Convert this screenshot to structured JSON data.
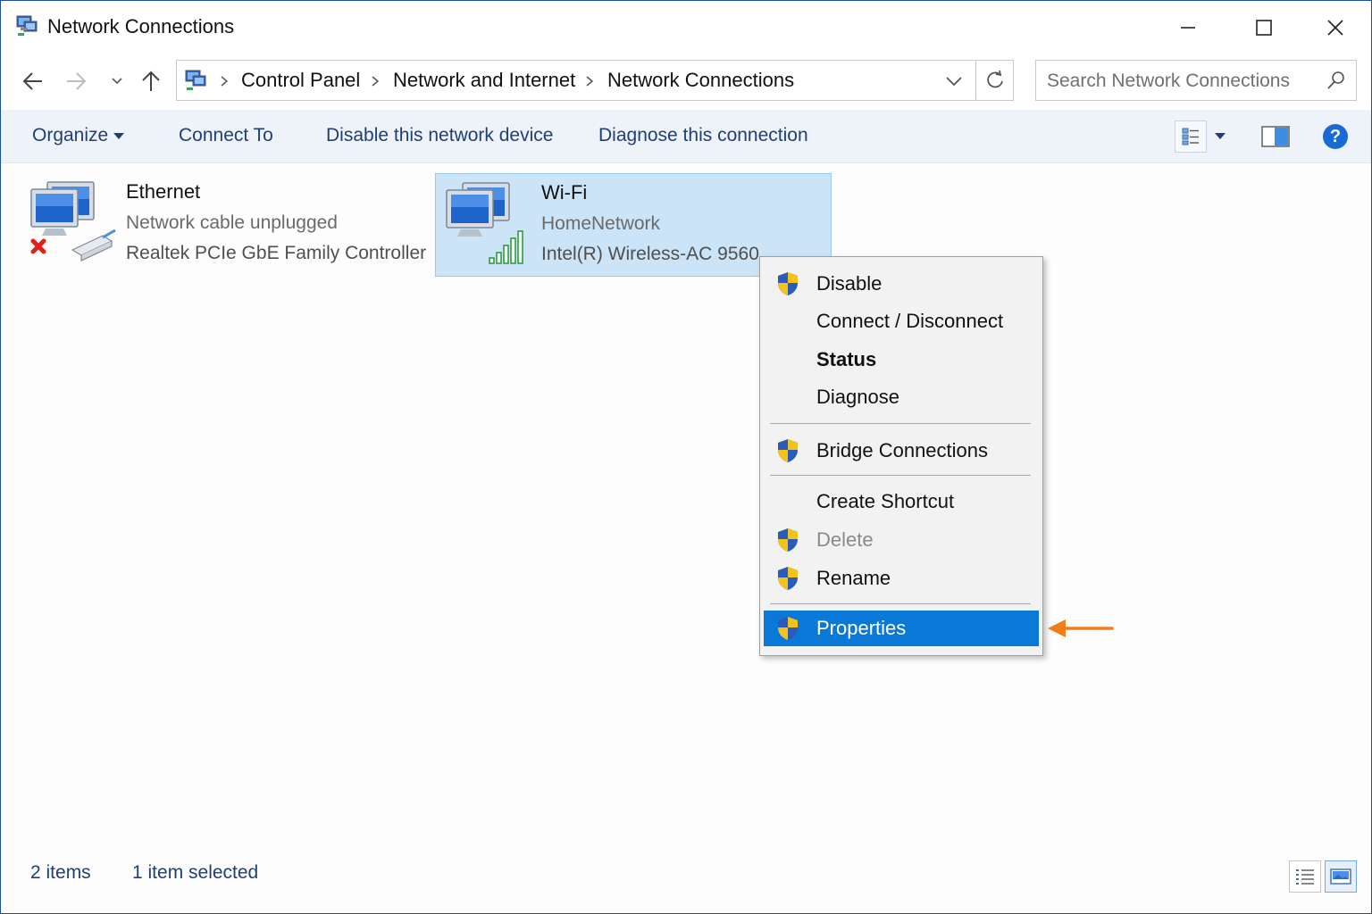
{
  "window": {
    "title": "Network Connections",
    "controls": {
      "minimize": "minimize",
      "maximize": "maximize",
      "close": "close"
    }
  },
  "address": {
    "breadcrumbs": [
      "Control Panel",
      "Network and Internet",
      "Network Connections"
    ],
    "search_placeholder": "Search Network Connections"
  },
  "commands": {
    "organize": "Organize",
    "connect_to": "Connect To",
    "disable_device": "Disable this network device",
    "diagnose_connection": "Diagnose this connection",
    "help": "?"
  },
  "connections": [
    {
      "name": "Ethernet",
      "status": "Network cable unplugged",
      "device": "Realtek PCIe GbE Family Controller",
      "icon": "ethernet-disconnected-icon"
    },
    {
      "name": "Wi-Fi",
      "status": "HomeNetwork",
      "device": "Intel(R) Wireless-AC 9560",
      "icon": "wifi-connected-icon",
      "selected": true
    }
  ],
  "context_menu": {
    "items": [
      {
        "label": "Disable",
        "shield": true
      },
      {
        "label": "Connect / Disconnect",
        "shield": false
      },
      {
        "label": "Status",
        "shield": false,
        "bold": true
      },
      {
        "label": "Diagnose",
        "shield": false
      },
      {
        "label": "Bridge Connections",
        "shield": true
      },
      {
        "label": "Create Shortcut",
        "shield": false
      },
      {
        "label": "Delete",
        "shield": true,
        "disabled": true
      },
      {
        "label": "Rename",
        "shield": true
      },
      {
        "label": "Properties",
        "shield": true,
        "highlighted": true
      }
    ]
  },
  "status_bar": {
    "item_count": "2 items",
    "selection": "1 item selected"
  },
  "colors": {
    "accent": "#0a78d7",
    "command_text": "#1e3f78",
    "selection_bg": "#cce4f7",
    "annotation_arrow": "#f07c1a"
  }
}
